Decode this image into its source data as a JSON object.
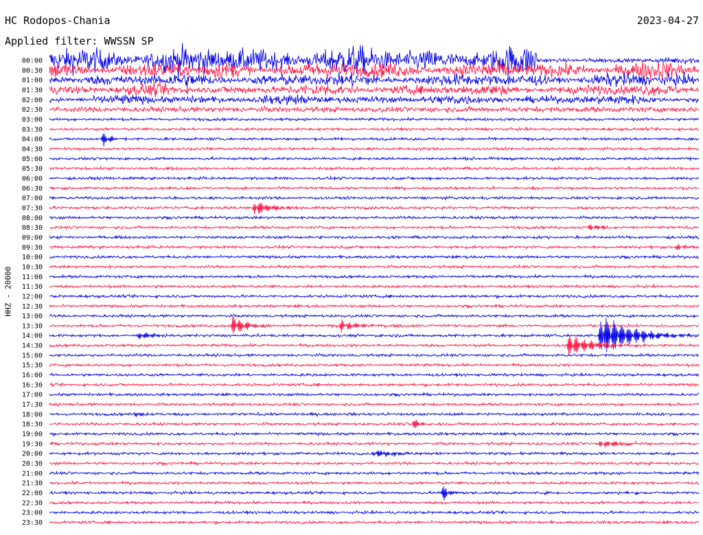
{
  "header": {
    "station": "HC Rodopos-Chania",
    "date": "2023-04-27",
    "filter": "Applied filter: WWSSN SP",
    "channel_label": "HHZ - 20000"
  },
  "colors": {
    "trace_a": "#0000e6",
    "trace_b": "#ff1744",
    "background": "#ffffff",
    "text": "#000000"
  },
  "chart_data": {
    "type": "line",
    "title": "HC Rodopos-Chania",
    "subtitle": "Applied filter: WWSSN SP",
    "ylabel": "HHZ - 20000",
    "xlabel": "",
    "rows": [
      "00:00",
      "00:30",
      "01:00",
      "01:30",
      "02:00",
      "02:30",
      "03:00",
      "03:30",
      "04:00",
      "04:30",
      "05:00",
      "05:30",
      "06:00",
      "06:30",
      "07:00",
      "07:30",
      "08:00",
      "08:30",
      "09:00",
      "09:30",
      "10:00",
      "10:30",
      "11:00",
      "11:30",
      "12:00",
      "12:30",
      "13:00",
      "13:30",
      "14:00",
      "14:30",
      "15:00",
      "15:30",
      "16:00",
      "16:30",
      "17:00",
      "17:30",
      "18:00",
      "18:30",
      "19:00",
      "19:30",
      "20:00",
      "20:30",
      "21:00",
      "21:30",
      "22:00",
      "22:30",
      "23:00",
      "23:30"
    ],
    "row_duration_minutes": 30,
    "grid": false,
    "legend": "none",
    "series": [
      {
        "color": "#0000e6",
        "rows": "00:00, 01:00, 02:00, ... (even rows)"
      },
      {
        "color": "#ff1744",
        "rows": "00:30, 01:30, 02:30, ... (odd rows)"
      }
    ],
    "noise_level_per_row": [
      9,
      9,
      7,
      6,
      5,
      3,
      1.6,
      1.6,
      1.6,
      1.6,
      1.6,
      1.6,
      1.6,
      1.6,
      1.6,
      1.6,
      1.6,
      1.6,
      1.6,
      1.6,
      1.6,
      1.6,
      1.6,
      1.6,
      1.6,
      1.6,
      1.6,
      1.6,
      1.6,
      1.6,
      1.6,
      1.6,
      1.6,
      1.6,
      1.6,
      1.6,
      1.6,
      1.6,
      1.6,
      1.6,
      1.6,
      1.6,
      1.6,
      1.6,
      1.6,
      1.6,
      1.6,
      1.6
    ],
    "events": [
      {
        "row": "04:00",
        "minute": 2.5,
        "amplitude": 11,
        "duration_min": 0.8
      },
      {
        "row": "07:30",
        "minute": 9.5,
        "amplitude": 13,
        "duration_min": 1.5
      },
      {
        "row": "08:30",
        "minute": 25,
        "amplitude": 6,
        "duration_min": 1
      },
      {
        "row": "09:30",
        "minute": 29,
        "amplitude": 5,
        "duration_min": 1
      },
      {
        "row": "13:30",
        "minute": 8.5,
        "amplitude": 16,
        "duration_min": 1.3
      },
      {
        "row": "13:30",
        "minute": 13.5,
        "amplitude": 10,
        "duration_min": 1.5
      },
      {
        "row": "14:00",
        "minute": 4.2,
        "amplitude": 8,
        "duration_min": 1
      },
      {
        "row": "14:00",
        "minute": 25.5,
        "amplitude": 36,
        "duration_min": 3
      },
      {
        "row": "14:30",
        "minute": 24,
        "amplitude": 18,
        "duration_min": 2.5
      },
      {
        "row": "18:00",
        "minute": 4,
        "amplitude": 5,
        "duration_min": 1
      },
      {
        "row": "18:30",
        "minute": 16.8,
        "amplitude": 9,
        "duration_min": 0.8
      },
      {
        "row": "19:30",
        "minute": 25.5,
        "amplitude": 8,
        "duration_min": 1.8
      },
      {
        "row": "20:00",
        "minute": 15,
        "amplitude": 7,
        "duration_min": 2
      },
      {
        "row": "22:00",
        "minute": 18.2,
        "amplitude": 12,
        "duration_min": 0.6
      }
    ]
  }
}
